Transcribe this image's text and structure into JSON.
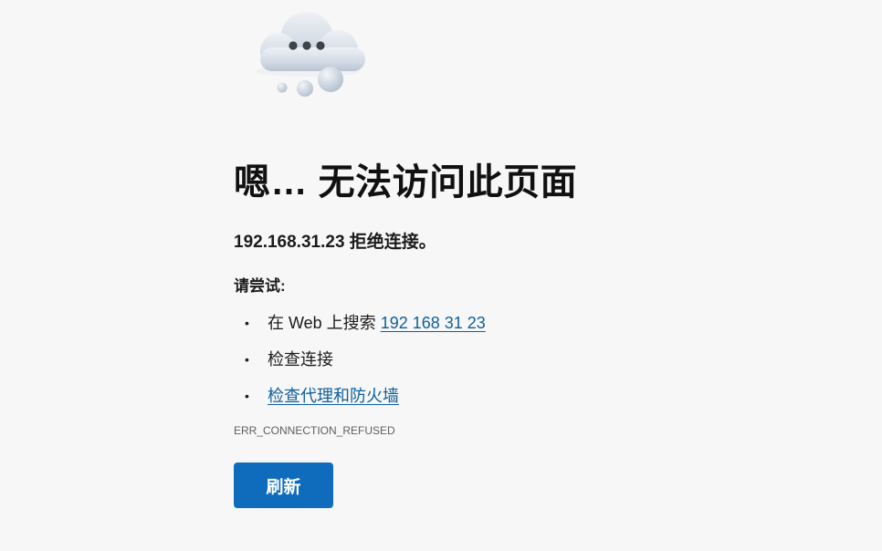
{
  "error_page": {
    "illustration_icon": "cloud-dots-icon",
    "title": "嗯… 无法访问此页面",
    "description": "192.168.31.23 拒绝连接。",
    "suggestions_heading": "请尝试:",
    "suggestions": [
      {
        "text": "在 Web 上搜索 ",
        "link_text": "192 168 31 23"
      },
      {
        "text": "检查连接"
      },
      {
        "link_text": "检查代理和防火墙"
      }
    ],
    "error_code": "ERR_CONNECTION_REFUSED",
    "refresh_label": "刷新"
  },
  "colors": {
    "background": "#f7f7f7",
    "link": "#0e5f9c",
    "button": "#0f6cbd"
  }
}
